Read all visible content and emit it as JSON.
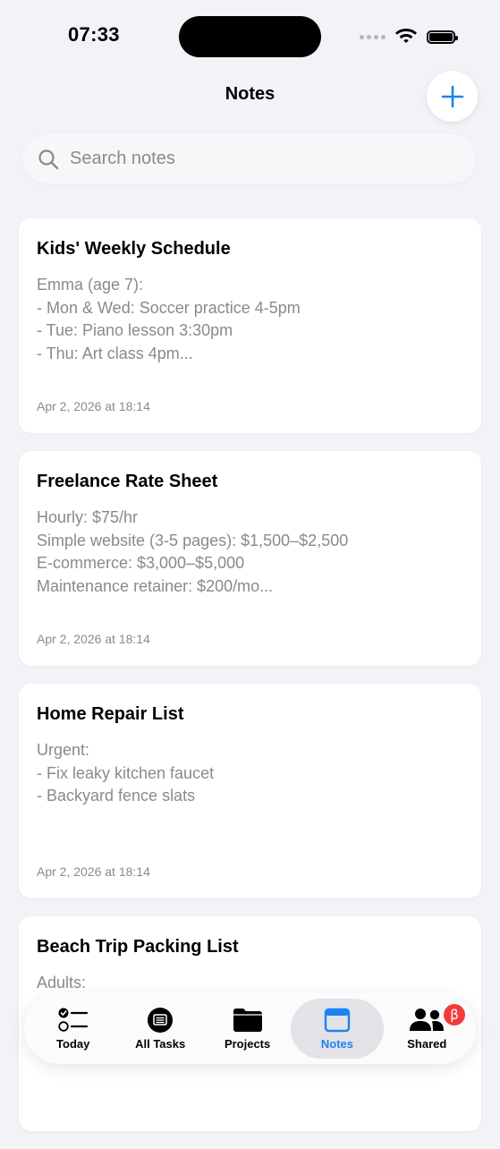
{
  "status_bar": {
    "time": "07:33"
  },
  "header": {
    "title": "Notes",
    "add_icon": "plus-icon"
  },
  "search": {
    "placeholder": "Search notes",
    "value": ""
  },
  "notes": [
    {
      "title": "Kids' Weekly Schedule",
      "preview": "Emma (age 7):\n- Mon & Wed: Soccer practice 4-5pm\n- Tue: Piano lesson 3:30pm\n- Thu: Art class 4pm...",
      "date": "Apr 2, 2026 at 18:14"
    },
    {
      "title": "Freelance Rate Sheet",
      "preview": "Hourly: $75/hr\nSimple website (3-5 pages): $1,500–$2,500\nE-commerce: $3,000–$5,000\nMaintenance retainer: $200/mo...",
      "date": "Apr 2, 2026 at 18:14"
    },
    {
      "title": "Home Repair List",
      "preview": "Urgent:\n- Fix leaky kitchen faucet\n- Backyard fence slats",
      "date": "Apr 2, 2026 at 18:14"
    },
    {
      "title": "Beach Trip Packing List",
      "preview": "Adults:",
      "date": ""
    }
  ],
  "tab_bar": {
    "tabs": [
      {
        "label": "Today",
        "icon": "checklist-icon",
        "active": false
      },
      {
        "label": "All Tasks",
        "icon": "tasks-icon",
        "active": false
      },
      {
        "label": "Projects",
        "icon": "folder-icon",
        "active": false
      },
      {
        "label": "Notes",
        "icon": "notes-icon",
        "active": true
      },
      {
        "label": "Shared",
        "icon": "people-icon",
        "active": false,
        "badge": "β"
      }
    ]
  },
  "colors": {
    "accent": "#1a84f0",
    "background": "#f2f2f7",
    "secondary_text": "#8a8a8e",
    "badge": "#f23c3c"
  }
}
